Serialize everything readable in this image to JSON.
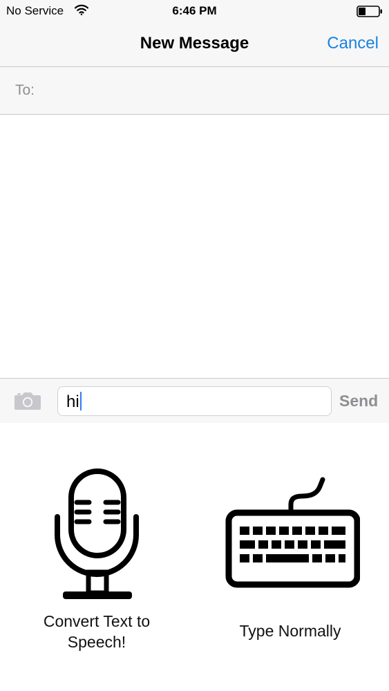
{
  "status_bar": {
    "carrier": "No Service",
    "time": "6:46 PM",
    "wifi_icon": "wifi-icon",
    "battery_icon": "battery-low-icon"
  },
  "nav": {
    "title": "New Message",
    "cancel_label": "Cancel"
  },
  "recipient": {
    "label": "To:",
    "value": ""
  },
  "composer": {
    "camera_icon": "camera-icon",
    "text_value": "hi",
    "send_label": "Send"
  },
  "keyboard_options": {
    "speech": {
      "icon": "microphone-icon",
      "label": "Convert Text to Speech!"
    },
    "typing": {
      "icon": "keyboard-icon",
      "label": "Type Normally"
    }
  },
  "colors": {
    "accent": "#1a82e2",
    "bar_background": "#f7f7f7",
    "separator": "#c8c7cc",
    "muted_text": "#8e8e93",
    "caret": "#3478f6"
  }
}
